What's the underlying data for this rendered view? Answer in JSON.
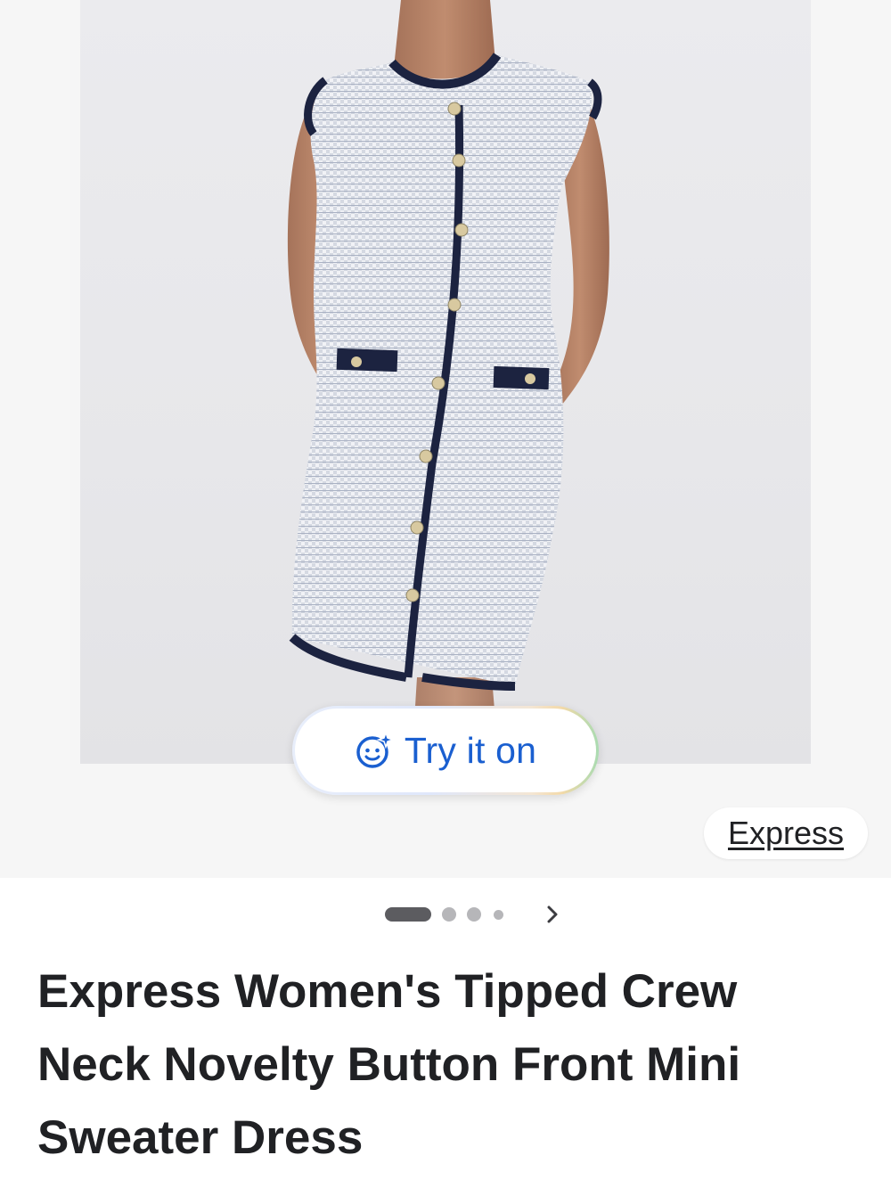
{
  "product": {
    "image_alt": "Woman wearing a light blue and white textured knit sleeveless mini dress with navy tipping and gold buttons",
    "title": "Express Women's Tipped Crew Neck Novelty Button Front Mini Sweater Dress"
  },
  "try_on": {
    "icon": "try-on-sparkle-face-icon",
    "label": "Try it on",
    "color": "#1a5fd0"
  },
  "source": {
    "label": "Express"
  },
  "carousel": {
    "total_dots": 4,
    "active_index": 0,
    "next_icon": "chevron-right-icon"
  },
  "colors": {
    "dress_knit": "#c9ced9",
    "dress_trim": "#1c2340",
    "button_gold": "#d8c9a0"
  }
}
